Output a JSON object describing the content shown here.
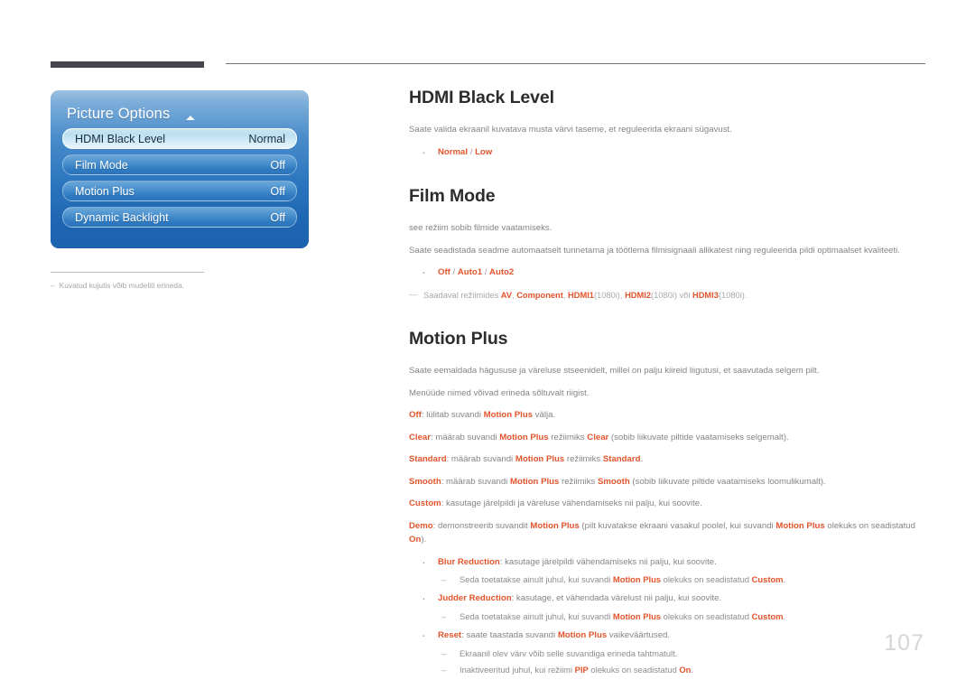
{
  "page": {
    "number": "107",
    "language_note": "Kuvatud kujutis võib mudeliti erineda.",
    "note_dash": "–"
  },
  "osd": {
    "title": "Picture Options",
    "caret_icon": "caret-up-icon",
    "rows": [
      {
        "label": "HDMI Black Level",
        "value": "Normal",
        "selected": true
      },
      {
        "label": "Film Mode",
        "value": "Off",
        "selected": false
      },
      {
        "label": "Motion Plus",
        "value": "Off",
        "selected": false
      },
      {
        "label": "Dynamic Backlight",
        "value": "Off",
        "selected": false
      }
    ]
  },
  "colors": {
    "accent_orange": "#e2542b",
    "panel_blue_top": "#9dc0e2",
    "panel_blue_bottom": "#1c62ae",
    "heading_dark": "#2c2c2e",
    "body_gray": "#85858a",
    "page_number_gray": "#d6d6d8"
  },
  "sections": {
    "hdmi_black_level": {
      "heading": "HDMI Black Level",
      "paragraph": "Saate valida ekraanil kuvatava musta värvi taseme, et reguleerida ekraani sügavust.",
      "options": {
        "first": "Normal",
        "slash": " / ",
        "second": "Low"
      }
    },
    "film_mode": {
      "heading": "Film Mode",
      "paragraph1": "see režiim sobib filmide vaatamiseks.",
      "paragraph2": "Saate seadistada seadme automaatselt tunnetama ja töötlema filmisignaali allikatest ning reguleerida pildi optimaalset kvaliteeti.",
      "options": {
        "o1": "Off",
        "s1": " / ",
        "o2": "Auto1",
        "s2": " / ",
        "o3": "Auto2"
      },
      "note": {
        "lead": "Saadaval režiimides ",
        "av": "AV",
        "comma1": ", ",
        "component": "Component",
        "comma2": ", ",
        "hdmi1": "HDMI1",
        "res1": "(1080i), ",
        "hdmi2": "HDMI2",
        "res2": "(1080i) või ",
        "hdmi3": "HDMI3",
        "res3": "(1080i)."
      }
    },
    "motion_plus": {
      "heading": "Motion Plus",
      "paragraph1": "Saate eemaldada hägususe ja väreluse stseenidelt, millel on palju kiireid liigutusi, et saavutada selgem pilt.",
      "paragraph2": "Menüüde nimed võivad erineda sõltuvalt riigist.",
      "modes": [
        {
          "term": "Off",
          "t1": ": lülitab suvandi ",
          "em1": "Motion Plus",
          "t2": " välja.",
          "em2": "",
          "t3": ""
        },
        {
          "term": "Clear",
          "t1": ": määrab suvandi ",
          "em1": "Motion Plus",
          "t2": " režiimiks ",
          "em2": "Clear",
          "t3": " (sobib liikuvate piltide vaatamiseks selgemalt)."
        },
        {
          "term": "Standard",
          "t1": ": määrab suvandi ",
          "em1": "Motion Plus",
          "t2": " režiimiks ",
          "em2": "Standard",
          "t3": "."
        },
        {
          "term": "Smooth",
          "t1": ": määrab suvandi ",
          "em1": "Motion Plus",
          "t2": " režiimiks ",
          "em2": "Smooth",
          "t3": " (sobib liikuvate piltide vaatamiseks loomulikumalt)."
        },
        {
          "term": "Custom",
          "t1": ": kasutage järelpildi ja väreluse vähendamiseks nii palju, kui soovite.",
          "em1": "",
          "t2": "",
          "em2": "",
          "t3": ""
        }
      ],
      "demo": {
        "term": "Demo",
        "t1": ": demonstreerib suvandit ",
        "em1": "Motion Plus",
        "t2": " (pilt kuvatakse ekraani vasakul poolel, kui suvandi ",
        "em2": "Motion Plus",
        "t3": " olekuks on seadistatud ",
        "em3": "On",
        "t4": ")."
      },
      "bullets": [
        {
          "term": "Blur Reduction",
          "rest": ": kasutage järelpildi vähendamiseks nii palju, kui soovite.",
          "sub": [
            {
              "t1": "Seda toetatakse ainult juhul, kui suvandi ",
              "em1": "Motion Plus",
              "t2": " olekuks on seadistatud ",
              "em2": "Custom",
              "t3": "."
            }
          ]
        },
        {
          "term": "Judder Reduction",
          "rest": ": kasutage, et vähendada värelust nii palju, kui soovite.",
          "sub": [
            {
              "t1": "Seda toetatakse ainult juhul, kui suvandi ",
              "em1": "Motion Plus",
              "t2": " olekuks on seadistatud ",
              "em2": "Custom",
              "t3": "."
            }
          ]
        },
        {
          "term": "Reset",
          "rest_pre": ": saate taastada suvandi ",
          "em_mid": "Motion Plus",
          "rest_post": " vaikeväärtused.",
          "sub": [
            {
              "t1": "Ekraanil olev värv võib selle suvandiga erineda tahtmatult.",
              "em1": "",
              "t2": "",
              "em2": "",
              "t3": ""
            },
            {
              "t1": "Inaktiveeritud juhul, kui režiimi ",
              "em1": "PIP",
              "t2": " olekuks on seadistatud ",
              "em2": "On",
              "t3": "."
            }
          ]
        }
      ]
    }
  }
}
